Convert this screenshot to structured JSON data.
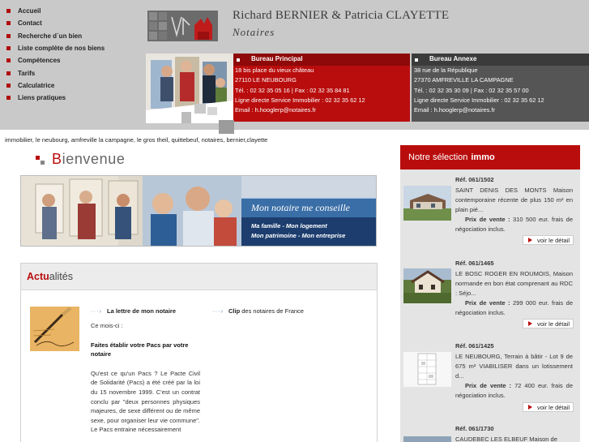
{
  "nav": {
    "items": [
      {
        "label": "Accueil"
      },
      {
        "label": "Contact"
      },
      {
        "label": "Recherche d´un bien"
      },
      {
        "label": "Liste complète de nos biens"
      },
      {
        "label": "Compétences"
      },
      {
        "label": "Tarifs"
      },
      {
        "label": "Calculatrice"
      },
      {
        "label": "Liens pratiques"
      }
    ]
  },
  "firm": {
    "names": "Richard BERNIER & Patricia CLAYETTE",
    "subtitle": "Notaires"
  },
  "offices": {
    "main": {
      "title": "Bureau Principal",
      "lines": [
        "18 bis place du vieux château",
        "27110 LE NEUBOURG",
        "Tél. : 02 32 35 05 16 | Fax : 02 32 35 84 81",
        "Ligne directe Service Immobilier : 02 32 35 62 12",
        "Email : h.hooglerp@notaires.fr"
      ]
    },
    "annex": {
      "title": "Bureau Annexe",
      "lines": [
        "38 rue de la République",
        "27370 AMFREVILLE LA CAMPAGNE",
        "Tél. : 02 32 35 30 09 | Fax : 02 32 35 57 00",
        "Ligne directe Service Immobilier : 02 32 35 62 12",
        "Email : h.hooglerp@notaires.fr"
      ]
    }
  },
  "keywords": "immobilier, le neubourg, amfreville la campagne, le gros theil, quittebeuf, notaires, bernier,clayette",
  "welcome": {
    "first": "B",
    "rest": "ienvenue"
  },
  "banner": {
    "title": "Mon notaire me conseille",
    "lines": [
      "Ma famille - Mon logement",
      "Mon patrimoine - Mon entreprise"
    ]
  },
  "news": {
    "title_bold": "Actu",
    "title_rest": "alités",
    "link1": {
      "bold": "La lettre de mon notaire"
    },
    "link2": {
      "bold": "Clip",
      "rest": " des notaires de France"
    },
    "intro": "Ce mois-ci :",
    "headline": "Faites établir votre Pacs par votre notaire",
    "body": "Qu'est ce qu'un Pacs ? Le Pacte Civil de Solidarité (Pacs) a été créé par la loi du 15 novembre 1999. C'est un contrat conclu par \"deux personnes physiques majeures, de sexe différent ou de même sexe, pour organiser leur vie commune\". Le Pacs entraine nécessairement"
  },
  "selection": {
    "title": "Notre sélection",
    "title_bold": "immo",
    "more_label": "voir le détail",
    "price_label": "Prix de vente :",
    "properties": [
      {
        "ref": "Réf. 061/1502",
        "desc": "SAINT DENIS DES MONTS Maison contemporaine récente de plus 150 m² en plain pié...",
        "price": " 310 500 eur. frais de négociation inclus."
      },
      {
        "ref": "Réf. 061/1465",
        "desc": "LE BOSC ROGER EN ROUMOIS, Maison normande en bon état comprenant au RDC : Séjo...",
        "price": " 299 000 eur. frais de négociation inclus."
      },
      {
        "ref": "Réf. 061/1425",
        "desc": "LE NEUBOURG, Terrain à bâtir - Lot 9 de 675 m² VIABILISER dans un lotissement d...",
        "price": " 72 400 eur. frais de négociation inclus."
      },
      {
        "ref": "Réf. 061/1730",
        "desc": "CAUDEBEC LES ELBEUF Maison de",
        "price": ""
      }
    ]
  },
  "colors": {
    "accent": "#b90d0d",
    "dark_red": "#8e0909",
    "annex_grey": "#555555",
    "banner_blue": "#1c3d6e"
  }
}
